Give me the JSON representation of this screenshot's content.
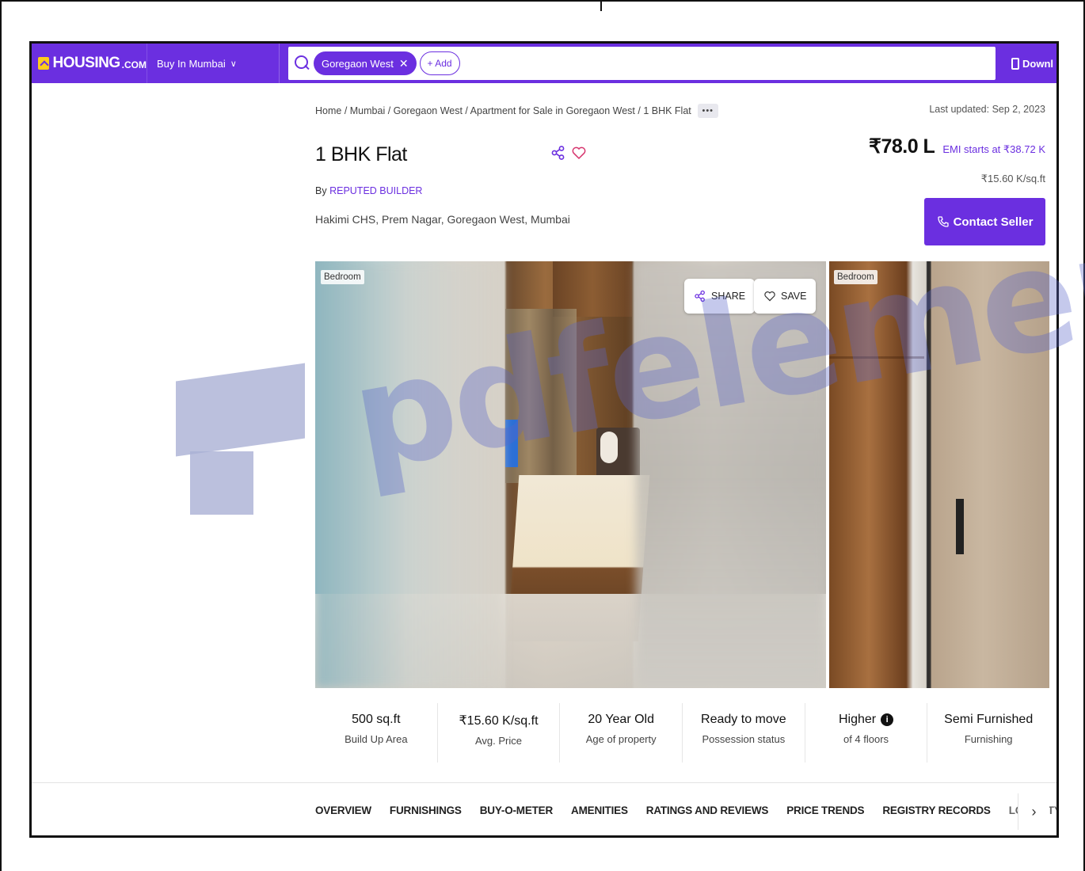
{
  "header": {
    "logo_text": "HOUSING",
    "logo_suffix": ".COM",
    "city_label": "Buy In Mumbai",
    "search_chip": "Goregaon West",
    "add_label": "+ Add",
    "download_label": "Downl"
  },
  "breadcrumb": "Home / Mumbai / Goregaon West / Apartment for Sale in Goregaon West / 1 BHK Flat",
  "more_label": "•••",
  "last_updated": "Last updated: Sep 2, 2023",
  "listing": {
    "title": "1 BHK Flat",
    "by_prefix": "By",
    "builder": "REPUTED BUILDER",
    "address": "Hakimi CHS, Prem Nagar, Goregaon West, Mumbai",
    "price": "₹78.0 L",
    "emi": "EMI starts at ₹38.72 K",
    "per_sqft": "₹15.60 K/sq.ft",
    "contact_label": "Contact Seller"
  },
  "gallery": {
    "tag_1": "Bedroom",
    "tag_2": "Bedroom",
    "share_label": "SHARE",
    "save_label": "SAVE"
  },
  "stats": [
    {
      "value": "500 sq.ft",
      "label": "Build Up Area"
    },
    {
      "value": "₹15.60 K/sq.ft",
      "label": "Avg. Price"
    },
    {
      "value": "20 Year Old",
      "label": "Age of property"
    },
    {
      "value": "Ready to move",
      "label": "Possession status"
    },
    {
      "value": "Higher",
      "label": "of 4 floors"
    },
    {
      "value": "Semi Furnished",
      "label": "Furnishing"
    }
  ],
  "tabs": [
    "OVERVIEW",
    "FURNISHINGS",
    "BUY-O-METER",
    "AMENITIES",
    "RATINGS AND REVIEWS",
    "PRICE TRENDS",
    "REGISTRY RECORDS",
    "LOCALITY"
  ],
  "tab_next": "›",
  "watermark": "pdfelement",
  "colors": {
    "brand": "#6b2fe0",
    "logo_yellow": "#ffcc1a"
  }
}
